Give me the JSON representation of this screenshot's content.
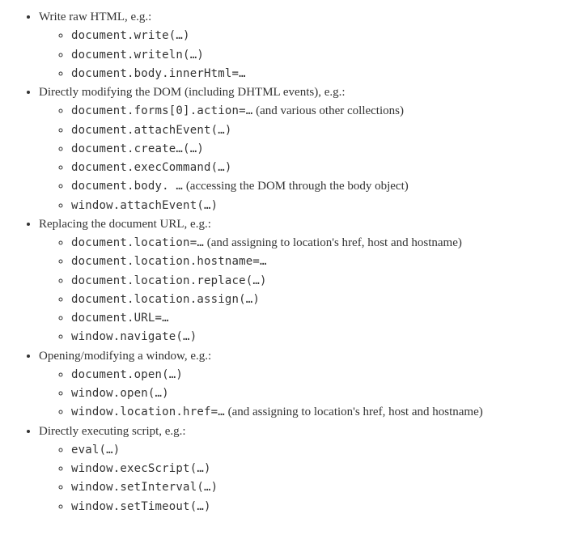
{
  "sections": [
    {
      "title": "Write raw HTML, e.g.:",
      "items": [
        {
          "code": "document.write(…)"
        },
        {
          "code": "document.writeln(…)"
        },
        {
          "code": "document.body.innerHtml=…"
        }
      ]
    },
    {
      "title": "Directly modifying the DOM (including DHTML events), e.g.:",
      "items": [
        {
          "code": "document.forms[0].action=…",
          "note": "  (and various other collections)"
        },
        {
          "code": "document.attachEvent(…)"
        },
        {
          "code": "document.create…(…)"
        },
        {
          "code": "document.execCommand(…)"
        },
        {
          "code": "document.body. …",
          "note": " (accessing the DOM through the body object)"
        },
        {
          "code": "window.attachEvent(…)"
        }
      ]
    },
    {
      "title": "Replacing the document URL, e.g.:",
      "items": [
        {
          "code": "document.location=…",
          "note": "  (and assigning to location's href, host and hostname)"
        },
        {
          "code": "document.location.hostname=…"
        },
        {
          "code": "document.location.replace(…)"
        },
        {
          "code": "document.location.assign(…)"
        },
        {
          "code": "document.URL=…"
        },
        {
          "code": "window.navigate(…)"
        }
      ]
    },
    {
      "title": "Opening/modifying a window, e.g.:",
      "items": [
        {
          "code": "document.open(…)"
        },
        {
          "code": "window.open(…)"
        },
        {
          "code": "window.location.href=…",
          "note": "  (and assigning to location's href, host and hostname)"
        }
      ]
    },
    {
      "title": "Directly executing script, e.g.:",
      "items": [
        {
          "code": "eval(…)"
        },
        {
          "code": "window.execScript(…)"
        },
        {
          "code": "window.setInterval(…)"
        },
        {
          "code": "window.setTimeout(…)"
        }
      ]
    }
  ]
}
